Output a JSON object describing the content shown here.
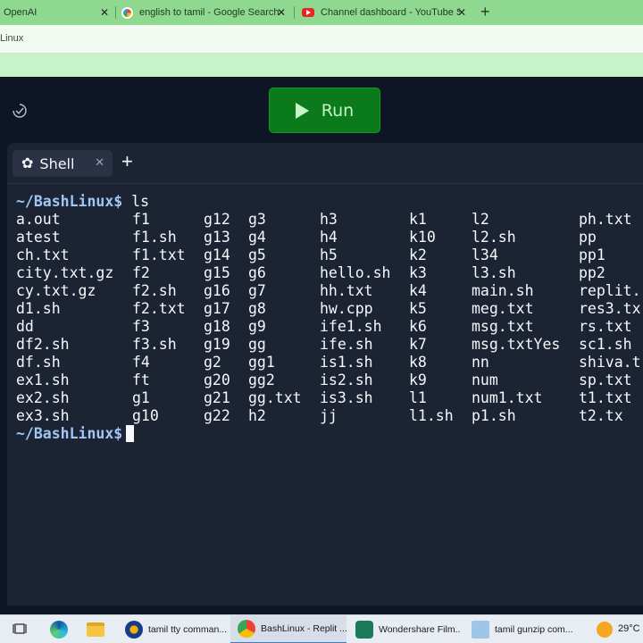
{
  "browser": {
    "tabs": [
      {
        "label": "OpenAI",
        "icon": "openai-icon"
      },
      {
        "label": "english to tamil - Google Search",
        "icon": "google-icon"
      },
      {
        "label": "Channel dashboard - YouTube St",
        "icon": "youtube-icon"
      }
    ],
    "address_text": "Linux"
  },
  "replit": {
    "run_label": "Run",
    "shell_tab_label": "Shell",
    "close_glyph": "✕",
    "add_glyph": "+"
  },
  "terminal": {
    "prompt": "~/BashLinux$",
    "command": "ls",
    "rows": [
      [
        "a.out",
        "f1",
        "g12",
        "g3",
        "h3",
        "k1",
        "l2",
        "ph.txt"
      ],
      [
        "atest",
        "f1.sh",
        "g13",
        "g4",
        "h4",
        "k10",
        "l2.sh",
        "pp"
      ],
      [
        "ch.txt",
        "f1.txt",
        "g14",
        "g5",
        "h5",
        "k2",
        "l34",
        "pp1"
      ],
      [
        "city.txt.gz",
        "f2",
        "g15",
        "g6",
        "hello.sh",
        "k3",
        "l3.sh",
        "pp2"
      ],
      [
        "cy.txt.gz",
        "f2.sh",
        "g16",
        "g7",
        "hh.txt",
        "k4",
        "main.sh",
        "replit."
      ],
      [
        "d1.sh",
        "f2.txt",
        "g17",
        "g8",
        "hw.cpp",
        "k5",
        "meg.txt",
        "res3.tx"
      ],
      [
        "dd",
        "f3",
        "g18",
        "g9",
        "ife1.sh",
        "k6",
        "msg.txt",
        "rs.txt"
      ],
      [
        "df2.sh",
        "f3.sh",
        "g19",
        "gg",
        "ife.sh",
        "k7",
        "msg.txtYes",
        "sc1.sh"
      ],
      [
        "df.sh",
        "f4",
        "g2",
        "gg1",
        "is1.sh",
        "k8",
        "nn",
        "shiva.t"
      ],
      [
        "ex1.sh",
        "ft",
        "g20",
        "gg2",
        "is2.sh",
        "k9",
        "num",
        "sp.txt"
      ],
      [
        "ex2.sh",
        "g1",
        "g21",
        "gg.txt",
        "is3.sh",
        "l1",
        "num1.txt",
        "t1.txt"
      ],
      [
        "ex3.sh",
        "g10",
        "g22",
        "h2",
        "jj",
        "l1.sh",
        "p1.sh",
        "t2.tx"
      ]
    ]
  },
  "taskbar": {
    "apps": [
      {
        "label": "tamil tty comman...",
        "icon": "chrome-profile-icon"
      },
      {
        "label": "BashLinux - Replit ...",
        "icon": "chrome-icon"
      },
      {
        "label": "Wondershare Film...",
        "icon": "filmora-icon"
      },
      {
        "label": "tamil gunzip com...",
        "icon": "notepad-icon"
      }
    ],
    "temperature": "29°C"
  }
}
